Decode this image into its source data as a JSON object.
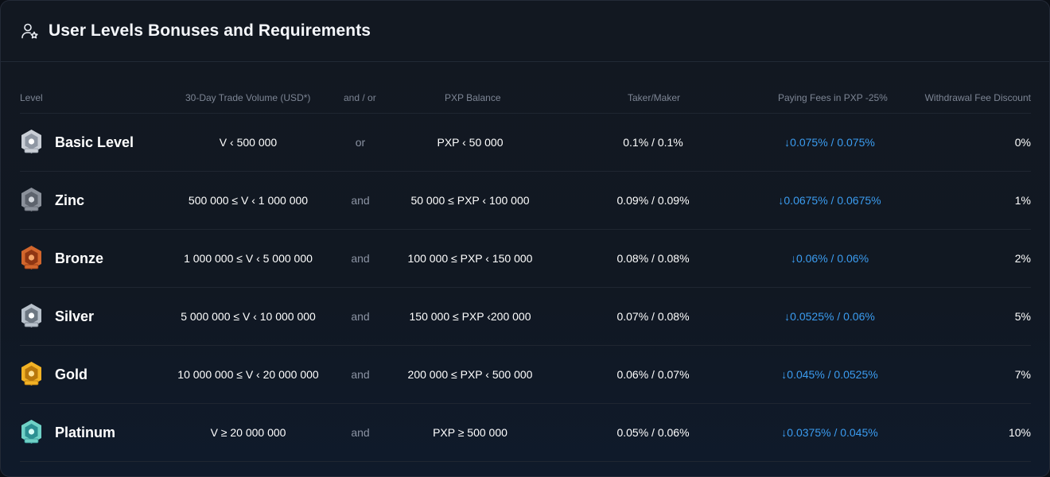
{
  "header": {
    "title": "User Levels Bonuses and Requirements",
    "icon": "user-star-icon"
  },
  "columns": {
    "level": "Level",
    "volume": "30-Day Trade Volume (USD*)",
    "andor": "and / or",
    "pxp": "PXP Balance",
    "taker_maker": "Taker/Maker",
    "fees_pxp": "Paying Fees in PXP -25%",
    "withdrawal": "Withdrawal Fee Discount"
  },
  "colors": {
    "accent_blue": "#3b9cf0",
    "muted": "#7d8594"
  },
  "rows": [
    {
      "name": "Basic Level",
      "badge": "basic-badge-icon",
      "volume": "V ‹ 500 000",
      "andor": "or",
      "pxp": "PXP ‹ 50 000",
      "taker_maker": "0.1% / 0.1%",
      "fees_pxp": "↓0.075% / 0.075%",
      "withdrawal": "0%"
    },
    {
      "name": "Zinc",
      "badge": "zinc-badge-icon",
      "volume": "500 000 ≤ V ‹ 1 000 000",
      "andor": "and",
      "pxp": "50 000 ≤ PXP ‹ 100 000",
      "taker_maker": "0.09% / 0.09%",
      "fees_pxp": "↓0.0675% / 0.0675%",
      "withdrawal": "1%"
    },
    {
      "name": "Bronze",
      "badge": "bronze-badge-icon",
      "volume": "1 000 000 ≤ V ‹ 5 000 000",
      "andor": "and",
      "pxp": "100 000 ≤ PXP ‹ 150 000",
      "taker_maker": "0.08% / 0.08%",
      "fees_pxp": "↓0.06% / 0.06%",
      "withdrawal": "2%"
    },
    {
      "name": "Silver",
      "badge": "silver-badge-icon",
      "volume": "5 000 000 ≤ V ‹ 10 000 000",
      "andor": "and",
      "pxp": "150 000 ≤ PXP ‹200 000",
      "taker_maker": "0.07% / 0.08%",
      "fees_pxp": "↓0.0525% / 0.06%",
      "withdrawal": "5%"
    },
    {
      "name": "Gold",
      "badge": "gold-badge-icon",
      "volume": "10 000 000 ≤ V ‹ 20 000 000",
      "andor": "and",
      "pxp": "200 000 ≤ PXP ‹ 500 000",
      "taker_maker": "0.06% / 0.07%",
      "fees_pxp": "↓0.045% / 0.0525%",
      "withdrawal": "7%"
    },
    {
      "name": "Platinum",
      "badge": "platinum-badge-icon",
      "volume": "V ≥ 20 000 000",
      "andor": "and",
      "pxp": "PXP ≥ 500 000",
      "taker_maker": "0.05% / 0.06%",
      "fees_pxp": "↓0.0375% / 0.045%",
      "withdrawal": "10%"
    }
  ]
}
